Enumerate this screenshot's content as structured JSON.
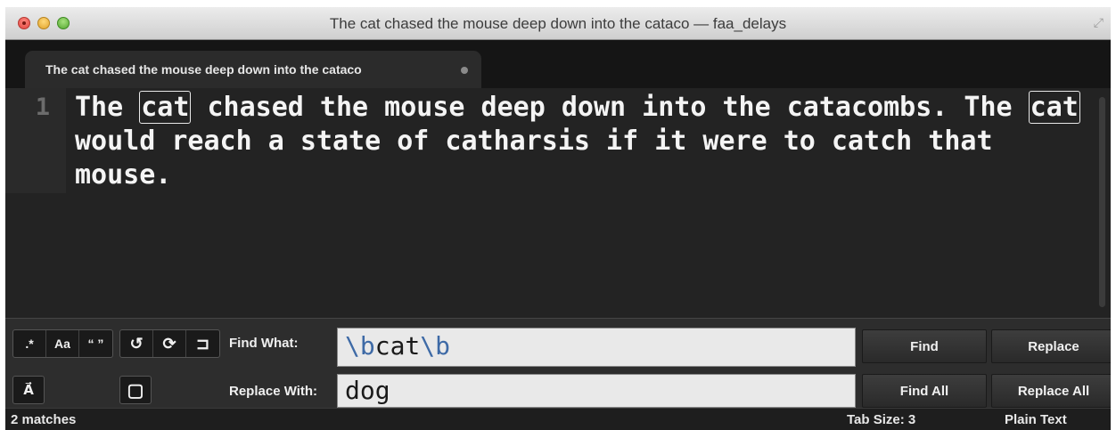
{
  "window": {
    "title": "The cat chased the mouse deep down into the cataco — faa_delays"
  },
  "tab": {
    "label": "The cat chased the mouse deep down into the cataco"
  },
  "editor": {
    "line_number": "1",
    "segments": [
      "The ",
      "cat",
      " chased the mouse deep down into the catacombs. The ",
      "cat",
      " would reach a state of catharsis if it were to catch that mouse."
    ]
  },
  "find_panel": {
    "options": {
      "regex": ".*",
      "case": "Aa",
      "whole_word": "“ ”",
      "wrap": "↺",
      "in_selection": "⟳",
      "highlight": "⊐",
      "preserve_case": "A⃗",
      "minimal": "▢"
    },
    "find_label": "Find What:",
    "find_value": {
      "esc1": "\\b",
      "term": "cat",
      "esc2": "\\b"
    },
    "replace_label": "Replace With:",
    "replace_value": "dog",
    "buttons": {
      "find": "Find",
      "replace": "Replace",
      "find_all": "Find All",
      "replace_all": "Replace All"
    }
  },
  "status": {
    "matches": "2 matches",
    "tab_size": "Tab Size: 3",
    "syntax": "Plain Text"
  }
}
